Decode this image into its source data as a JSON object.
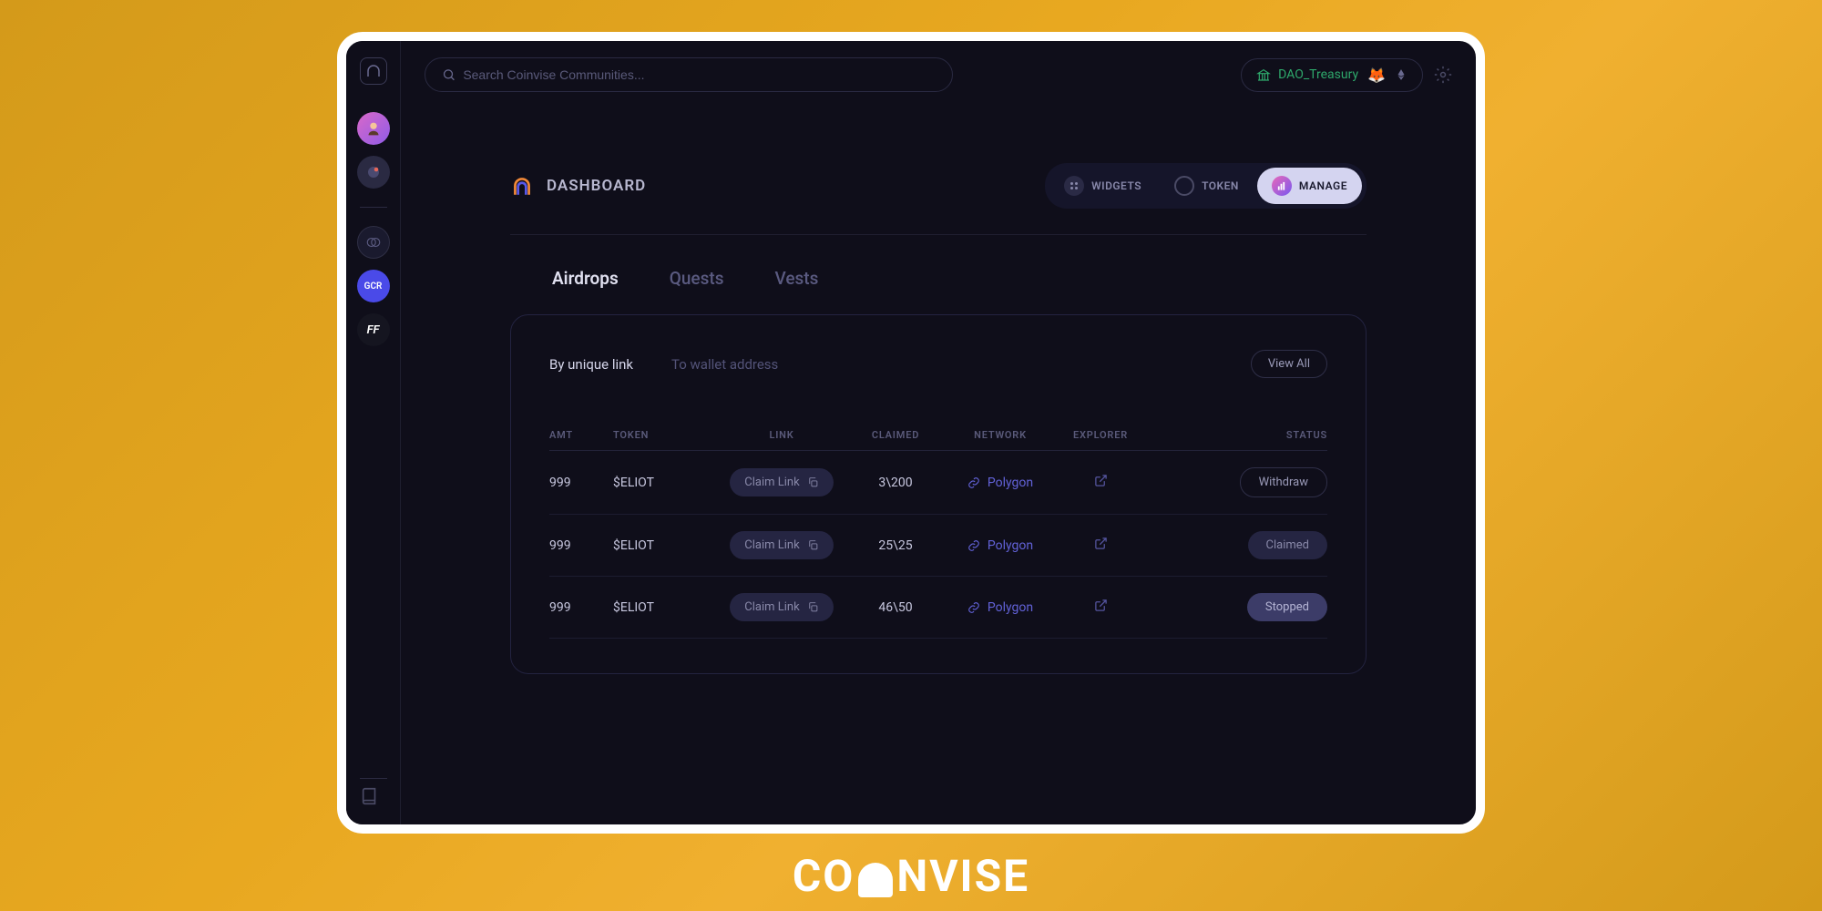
{
  "search": {
    "placeholder": "Search Coinvise Communities..."
  },
  "wallet": {
    "label": "DAO_Treasury",
    "icon": "🦊"
  },
  "sidebar": {
    "gcr": "GCR",
    "ff": "FF"
  },
  "page": {
    "title": "DASHBOARD"
  },
  "toggle": {
    "widgets": "WIDGETS",
    "token": "TOKEN",
    "manage": "MANAGE"
  },
  "tabs": {
    "airdrops": "Airdrops",
    "quests": "Quests",
    "vests": "Vests"
  },
  "subtabs": {
    "unique": "By unique link",
    "wallet": "To wallet address",
    "viewall": "View All"
  },
  "headers": {
    "amt": "AMT",
    "token": "TOKEN",
    "link": "LINK",
    "claimed": "CLAIMED",
    "network": "NETWORK",
    "explorer": "EXPLORER",
    "status": "STATUS"
  },
  "claim_link_label": "Claim Link",
  "rows": [
    {
      "amt": "999",
      "token": "$ELIOT",
      "claimed": "3\\200",
      "network": "Polygon",
      "status": "Withdraw",
      "status_class": "status-withdraw"
    },
    {
      "amt": "999",
      "token": "$ELIOT",
      "claimed": "25\\25",
      "network": "Polygon",
      "status": "Claimed",
      "status_class": "status-claimed"
    },
    {
      "amt": "999",
      "token": "$ELIOT",
      "claimed": "46\\50",
      "network": "Polygon",
      "status": "Stopped",
      "status_class": "status-stopped"
    }
  ],
  "brand": {
    "pre": "CO",
    "post": "NVISE"
  }
}
